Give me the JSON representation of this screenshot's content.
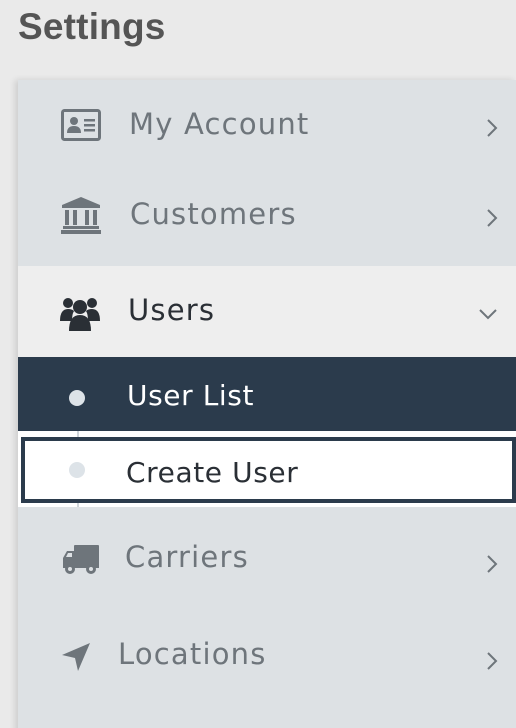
{
  "page": {
    "title": "Settings"
  },
  "menu": {
    "items": [
      {
        "label": "My Account",
        "icon": "id-card-icon",
        "expanded": false
      },
      {
        "label": "Customers",
        "icon": "bank-icon",
        "expanded": false
      },
      {
        "label": "Users",
        "icon": "users-icon",
        "expanded": true,
        "children": [
          {
            "label": "User List",
            "active": true
          },
          {
            "label": "Create User",
            "active": false
          }
        ]
      },
      {
        "label": "Carriers",
        "icon": "truck-icon",
        "expanded": false
      },
      {
        "label": "Locations",
        "icon": "location-arrow-icon",
        "expanded": false
      }
    ]
  },
  "colors": {
    "menu_bg": "#dde1e4",
    "expanded_bg": "#eeeeee",
    "active_bg": "#2b3b4c",
    "muted_text": "#6e757b",
    "title_text": "#555555"
  }
}
